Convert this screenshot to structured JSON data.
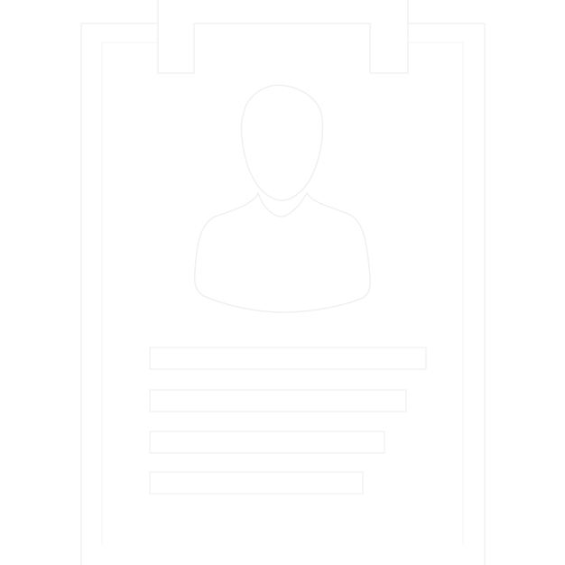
{
  "icon": {
    "name": "resume-clipboard-icon",
    "stroke_color": "#f2f2f2",
    "fill_color": "#ffffff",
    "background": "#ffffff"
  },
  "parts": {
    "clipboard": "clipboard-board",
    "clip": "clipboard-clip",
    "avatar": "person-avatar-icon",
    "text_lines": 4
  }
}
